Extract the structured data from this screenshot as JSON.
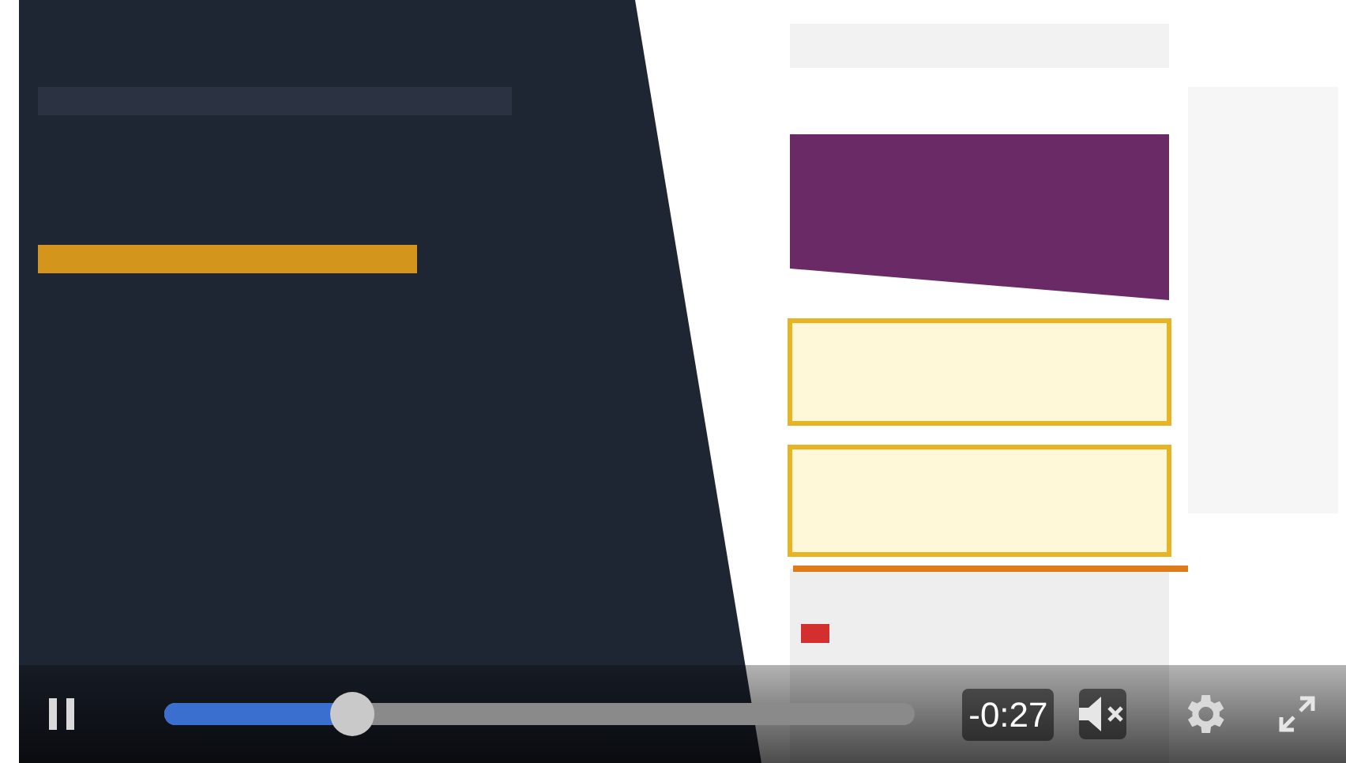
{
  "controls": {
    "playing": true,
    "progress": {
      "level": 0.25
    },
    "time_remaining": "-0:27"
  }
}
